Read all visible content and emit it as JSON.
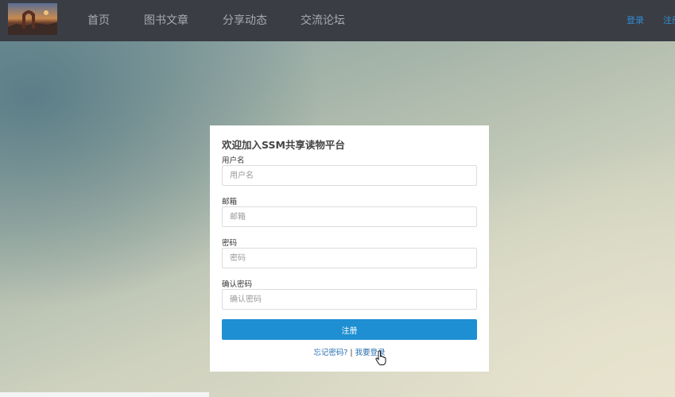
{
  "navbar": {
    "items": [
      {
        "label": "首页"
      },
      {
        "label": "图书文章"
      },
      {
        "label": "分享动态"
      },
      {
        "label": "交流论坛"
      }
    ],
    "login_label": "登录",
    "register_label": "注册"
  },
  "form": {
    "title": "欢迎加入SSM共享读物平台",
    "fields": [
      {
        "label": "用户名",
        "placeholder": "用户名"
      },
      {
        "label": "邮箱",
        "placeholder": "邮箱"
      },
      {
        "label": "密码",
        "placeholder": "密码"
      },
      {
        "label": "确认密码",
        "placeholder": "确认密码"
      }
    ],
    "submit_label": "注册",
    "forgot_label": "忘记密码?",
    "separator": " | ",
    "login_link_label": "我要登录"
  },
  "colors": {
    "navbar": "#3a3d44",
    "accent": "#1e8fd2",
    "link": "#2f8fd8"
  }
}
